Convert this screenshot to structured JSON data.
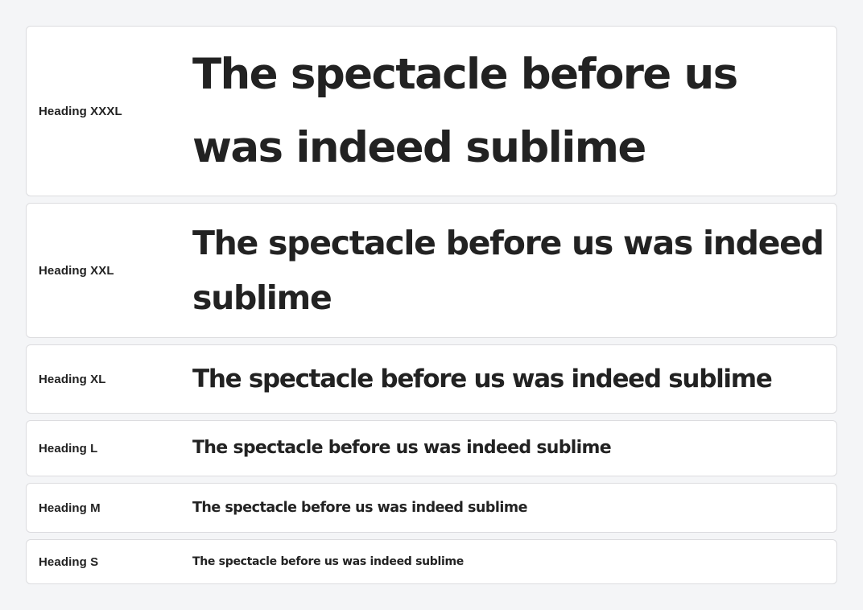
{
  "headings": [
    {
      "label": "Heading XXXL",
      "sample": "The spectacle before us was indeed sublime"
    },
    {
      "label": "Heading XXL",
      "sample": "The spectacle before us was indeed sublime"
    },
    {
      "label": "Heading XL",
      "sample": "The spectacle before us was indeed sublime"
    },
    {
      "label": "Heading L",
      "sample": "The spectacle before us was indeed sublime"
    },
    {
      "label": "Heading M",
      "sample": "The spectacle before us was indeed sublime"
    },
    {
      "label": "Heading S",
      "sample": "The spectacle before us was indeed sublime"
    }
  ],
  "colors": {
    "background": "#f4f5f7",
    "card": "#ffffff",
    "border": "#dcdcdf",
    "text": "#222222"
  }
}
